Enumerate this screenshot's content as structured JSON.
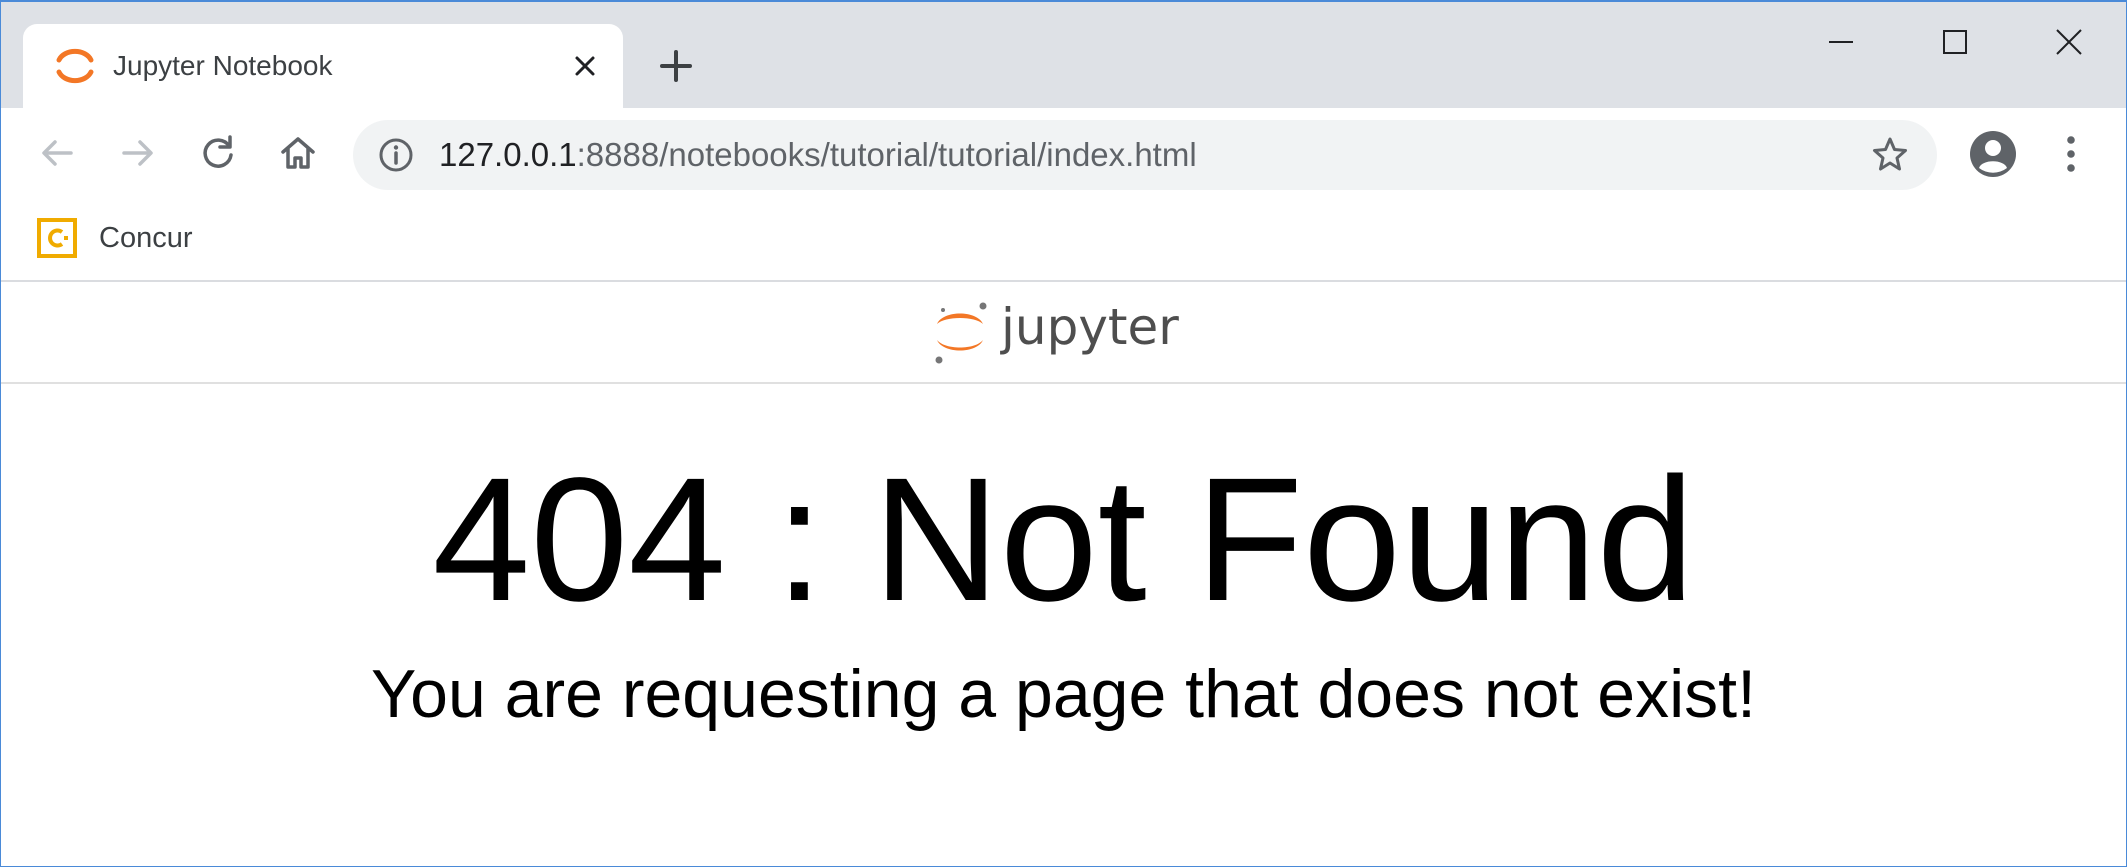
{
  "browser": {
    "tab": {
      "title": "Jupyter Notebook",
      "favicon": "jupyter-logo-icon"
    },
    "address": {
      "host": "127.0.0.1",
      "path": ":8888/notebooks/tutorial/tutorial/index.html"
    },
    "bookmarks": [
      {
        "label": "Concur",
        "icon": "concur-icon"
      }
    ],
    "accent_colors": {
      "jupyter_orange": "#f37726",
      "concur_yellow": "#f0ab00",
      "icon_gray": "#5f6368"
    }
  },
  "page": {
    "logo_text": "jupyter",
    "error_title": "404 : Not Found",
    "error_message": "You are requesting a page that does not exist!"
  }
}
